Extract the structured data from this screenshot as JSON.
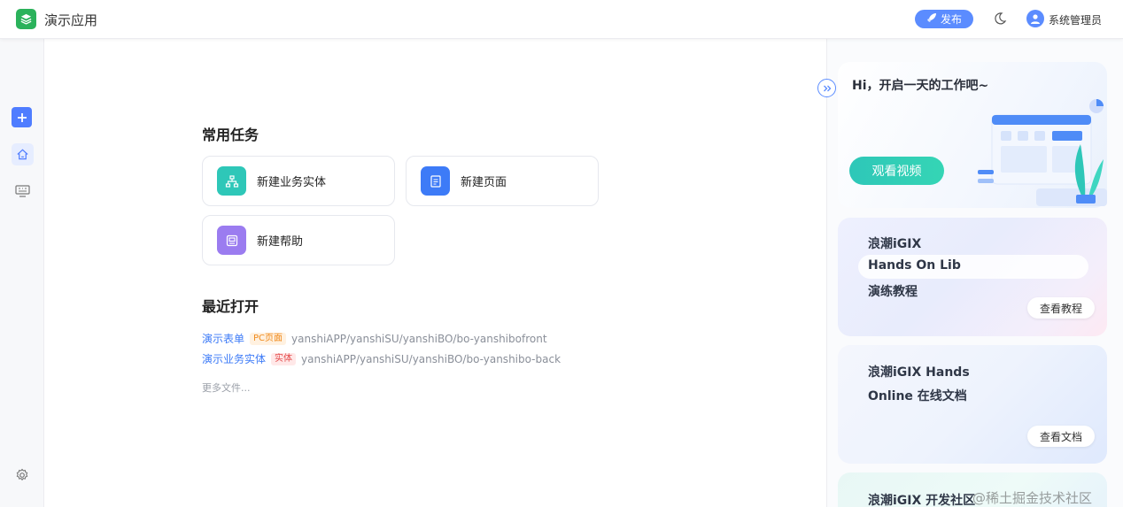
{
  "header": {
    "app_title": "演示应用",
    "publish_label": "发布",
    "user_name": "系统管理员"
  },
  "main": {
    "common_tasks_title": "常用任务",
    "tasks": [
      {
        "label": "新建业务实体",
        "icon": "org-chart-icon",
        "color": "#2ec7b8"
      },
      {
        "label": "新建页面",
        "icon": "page-icon",
        "color": "#3d7bf7"
      },
      {
        "label": "新建帮助",
        "icon": "help-icon",
        "color": "#9b7cf0"
      }
    ],
    "recent_title": "最近打开",
    "recent": [
      {
        "name": "演示表单",
        "tag": "PC页面",
        "path": "yanshiAPP/yanshiSU/yanshiBO/bo-yanshibofront"
      },
      {
        "name": "演示业务实体",
        "tag": "实体",
        "path": "yanshiAPP/yanshiSU/yanshiBO/bo-yanshibo-back"
      }
    ],
    "more_files": "更多文件..."
  },
  "right_panel": {
    "welcome": "Hi，开启一天的工作吧~",
    "watch_video": "观看视频",
    "card1": {
      "line1": "浪潮iGIX",
      "line2": "Hands On Lib",
      "line3": "演练教程",
      "button": "查看教程"
    },
    "card2": {
      "line1": "浪潮iGIX Hands",
      "line2": "Online 在线文档",
      "button": "查看文档"
    },
    "card3": {
      "line1": "浪潮iGIX 开发社区"
    }
  },
  "watermark": "@稀土掘金技术社区",
  "colors": {
    "accent": "#5b8cff",
    "teal": "#2ec7b8",
    "link": "#3d7bf7"
  }
}
